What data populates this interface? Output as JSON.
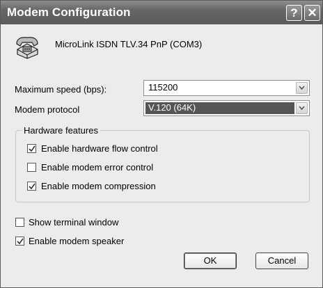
{
  "window": {
    "title": "Modem Configuration",
    "help_label": "?",
    "close_label": "✕"
  },
  "device": {
    "name": "MicroLink ISDN TLV.34 PnP (COM3)",
    "icon": "modem-phone-icon"
  },
  "max_speed": {
    "label": "Maximum speed (bps):",
    "value": "115200"
  },
  "protocol": {
    "label": "Modem protocol",
    "value": "V.120 (64K)"
  },
  "hardware": {
    "title": "Hardware features",
    "options": [
      {
        "label": "Enable hardware flow control",
        "checked": true
      },
      {
        "label": "Enable modem error control",
        "checked": false
      },
      {
        "label": "Enable modem compression",
        "checked": true
      }
    ]
  },
  "options": [
    {
      "label": "Show terminal window",
      "checked": false
    },
    {
      "label": "Enable modem speaker",
      "checked": true
    }
  ],
  "buttons": {
    "ok": "OK",
    "cancel": "Cancel"
  }
}
